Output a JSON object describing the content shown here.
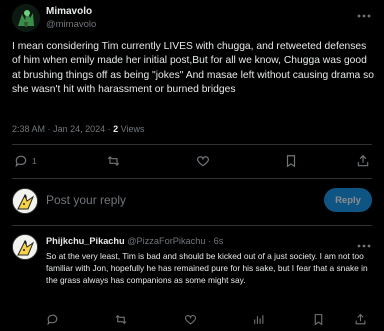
{
  "tweet": {
    "author_name": "Mimavolo",
    "author_handle": "@mimavolo",
    "text": "I mean considering Tim currently LIVES with chugga, and retweeted defenses of him when emily made her initial post,But for all we know, Chugga was good at brushing things off as being \"jokes\" And masae left without causing drama so she wasn't hit with harassment or burned bridges",
    "time": "2:38 AM",
    "date": "Jan 24, 2024",
    "separator": "·",
    "views_count": "2",
    "views_label": "Views",
    "reply_count": "1",
    "retweet_count": "",
    "like_count": ""
  },
  "reply_box": {
    "placeholder": "Post your reply",
    "button_label": "Reply"
  },
  "reply": {
    "author_name": "Phijkchu_Pikachu",
    "author_handle": "@PizzaForPikachu",
    "separator": "·",
    "time": "6s",
    "text": "So at the very least, Tim is bad and should be kicked out of a just society. I am not too familiar with Jon, hopefully he has remained pure for his sake, but I fear that a snake in the grass always has companions as some might say."
  },
  "colors": {
    "background": "#000000",
    "text_primary": "#e7e9ea",
    "text_secondary": "#71767b",
    "accent": "#1d9bf0",
    "divider": "#2f3336"
  },
  "icons": {
    "more": "more-horizontal-icon",
    "reply": "comment-bubble-icon",
    "retweet": "retweet-icon",
    "like": "heart-icon",
    "bookmark": "bookmark-icon",
    "share": "share-icon",
    "views": "bar-chart-icon"
  }
}
